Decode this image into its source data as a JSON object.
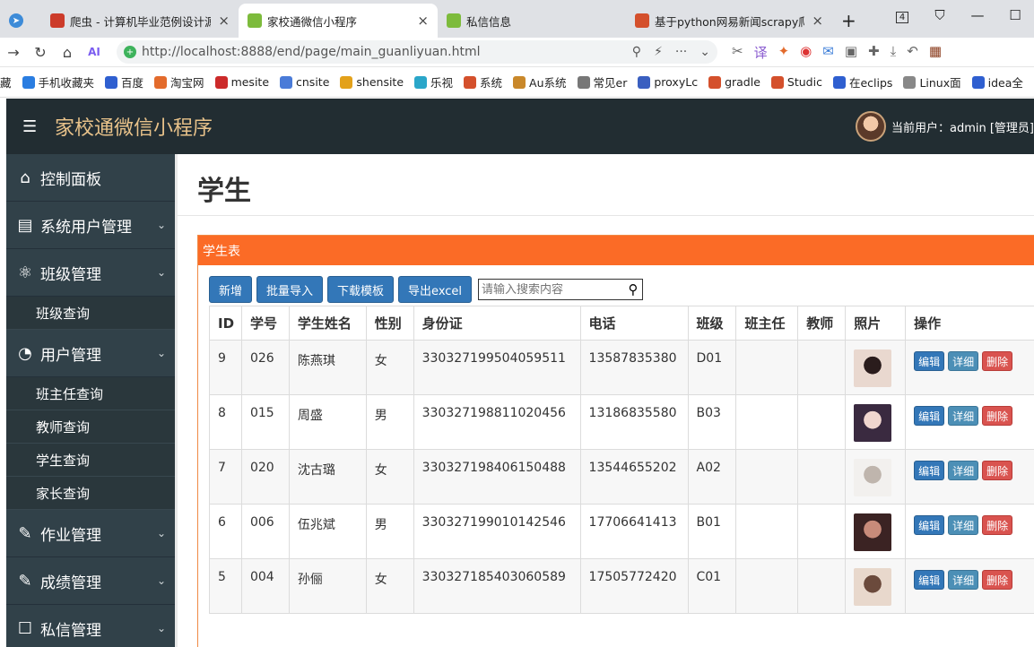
{
  "browser": {
    "tabs": [
      {
        "title": "爬虫 - 计算机毕业范例设计源",
        "color": "#cc3b2a",
        "active": false
      },
      {
        "title": "家校通微信小程序",
        "color": "#7dbb3c",
        "active": true
      },
      {
        "title": "私信信息",
        "color": "#7dbb3c",
        "active": false
      },
      {
        "title": "基于python网易新闻scrapy爬",
        "color": "#d4502c",
        "active": false
      }
    ],
    "tab_count": "4",
    "url": "http://localhost:8888/end/page/main_guanliyuan.html",
    "bookmarks": [
      "藏",
      "手机收藏夹",
      "百度",
      "淘宝网",
      "mesite",
      "cnsite",
      "shensite",
      "乐视",
      "系统",
      "Au系统",
      "常见er",
      "proxyLc",
      "gradle",
      "Studic",
      "在eclips",
      "Linux面",
      "idea全"
    ]
  },
  "app": {
    "title": "家校通微信小程序",
    "user_label": "当前用户：admin [管理员]"
  },
  "sidebar": {
    "items": [
      {
        "icon": "home-icon",
        "glyph": "⌂",
        "label": "控制面板",
        "arrow": false,
        "subs": []
      },
      {
        "icon": "list-icon",
        "glyph": "▤",
        "label": "系统用户管理",
        "arrow": true,
        "subs": []
      },
      {
        "icon": "atom-icon",
        "glyph": "⚛",
        "label": "班级管理",
        "arrow": true,
        "subs": [
          "班级查询"
        ]
      },
      {
        "icon": "pie-chart-icon",
        "glyph": "◔",
        "label": "用户管理",
        "arrow": true,
        "subs": [
          "班主任查询",
          "教师查询",
          "学生查询",
          "家长查询"
        ]
      },
      {
        "icon": "edit-icon",
        "glyph": "✎",
        "label": "作业管理",
        "arrow": true,
        "subs": []
      },
      {
        "icon": "edit-icon",
        "glyph": "✎",
        "label": "成绩管理",
        "arrow": true,
        "subs": []
      },
      {
        "icon": "square-icon",
        "glyph": "☐",
        "label": "私信管理",
        "arrow": true,
        "subs": []
      }
    ]
  },
  "page": {
    "title": "学生",
    "panel_title": "学生表",
    "toolbar": {
      "add": "新增",
      "import": "批量导入",
      "template": "下载模板",
      "export": "导出excel",
      "search_placeholder": "请输入搜索内容"
    },
    "columns": [
      "ID",
      "学号",
      "学生姓名",
      "性别",
      "身份证",
      "电话",
      "班级",
      "班主任",
      "教师",
      "照片",
      "操作"
    ],
    "rows": [
      {
        "id": "9",
        "no": "026",
        "name": "陈燕琪",
        "gender": "女",
        "idcard": "330327199504059511",
        "phone": "13587835380",
        "cls": "D01",
        "head": "",
        "teacher": "",
        "photo": [
          "#e9d8cf",
          "#2a1c1c"
        ]
      },
      {
        "id": "8",
        "no": "015",
        "name": "周盛",
        "gender": "男",
        "idcard": "330327198811020456",
        "phone": "13186835580",
        "cls": "B03",
        "head": "",
        "teacher": "",
        "photo": [
          "#3a2a40",
          "#f0d6cf"
        ]
      },
      {
        "id": "7",
        "no": "020",
        "name": "沈古璐",
        "gender": "女",
        "idcard": "330327198406150488",
        "phone": "13544655202",
        "cls": "A02",
        "head": "",
        "teacher": "",
        "photo": [
          "#f2f0ee",
          "#bfb5ad"
        ]
      },
      {
        "id": "6",
        "no": "006",
        "name": "伍兆斌",
        "gender": "男",
        "idcard": "330327199010142546",
        "phone": "17706641413",
        "cls": "B01",
        "head": "",
        "teacher": "",
        "photo": [
          "#3b2323",
          "#c88b7a"
        ]
      },
      {
        "id": "5",
        "no": "004",
        "name": "孙俪",
        "gender": "女",
        "idcard": "330327185403060589",
        "phone": "17505772420",
        "cls": "C01",
        "head": "",
        "teacher": "",
        "photo": [
          "#e8d8cc",
          "#6b4a3c"
        ]
      }
    ],
    "ops": {
      "edit": "编辑",
      "detail": "详细",
      "delete": "删除"
    }
  }
}
